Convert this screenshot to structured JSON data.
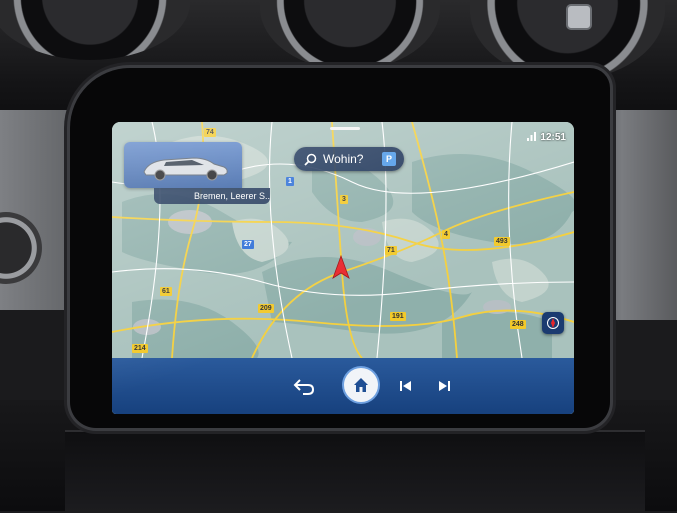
{
  "status": {
    "time": "12:51",
    "signal_icon": "signal-bars-icon"
  },
  "search": {
    "label": "Wohin?",
    "parking_badge": "P"
  },
  "vehicle": {
    "address": "Bremen, Leerer S..."
  },
  "map": {
    "road_labels": [
      {
        "text": "74",
        "kind": "yellow"
      },
      {
        "text": "1",
        "kind": "blue"
      },
      {
        "text": "3",
        "kind": "yellow"
      },
      {
        "text": "27",
        "kind": "blue"
      },
      {
        "text": "71",
        "kind": "yellow"
      },
      {
        "text": "4",
        "kind": "yellow"
      },
      {
        "text": "493",
        "kind": "yellow"
      },
      {
        "text": "61",
        "kind": "yellow"
      },
      {
        "text": "209",
        "kind": "yellow"
      },
      {
        "text": "191",
        "kind": "yellow"
      },
      {
        "text": "248",
        "kind": "yellow"
      },
      {
        "text": "214",
        "kind": "yellow"
      }
    ]
  },
  "bottom_bar": {
    "icons": [
      "back-arrow-icon",
      "home-icon",
      "skip-previous-icon",
      "skip-next-icon"
    ]
  },
  "colors": {
    "bar": "#17417e",
    "pill": "#162d52",
    "accent": "#4f9ae8",
    "position_arrow": "#e8262b"
  }
}
